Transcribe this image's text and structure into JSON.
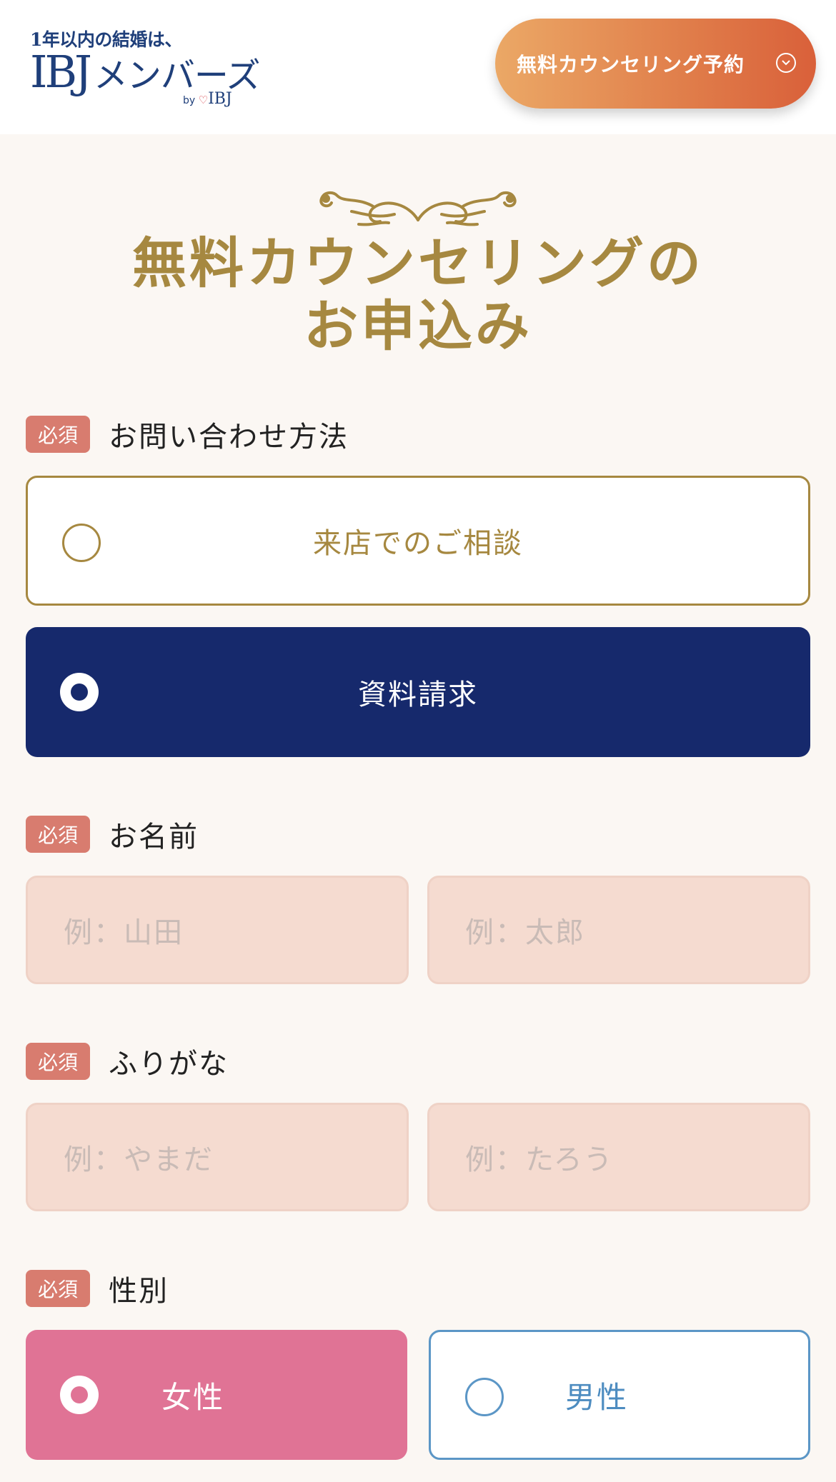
{
  "header": {
    "logo_tagline": "1年以内の結婚は、",
    "logo_brand": "IBJ",
    "logo_members": "メンバーズ",
    "logo_by": "by",
    "logo_by_brand": "IBJ",
    "cta_label": "無料カウンセリング予約",
    "cta_icon": "chevron-down-circle-icon",
    "colors": {
      "cta_start": "#eba866",
      "cta_end": "#d9603a",
      "brand_navy": "#1f3f7a"
    }
  },
  "page": {
    "title_line1": "無料カウンセリングの",
    "title_line2": "お申込み",
    "accent_gold": "#a68840"
  },
  "form": {
    "required_label": "必須",
    "contact_method": {
      "label": "お問い合わせ方法",
      "options": [
        {
          "label": "来店でのご相談",
          "selected": false
        },
        {
          "label": "資料請求",
          "selected": true
        }
      ]
    },
    "name": {
      "label": "お名前",
      "last_placeholder": "例：山田",
      "first_placeholder": "例：太郎"
    },
    "furigana": {
      "label": "ふりがな",
      "last_placeholder": "例：やまだ",
      "first_placeholder": "例：たろう"
    },
    "gender": {
      "label": "性別",
      "options": [
        {
          "label": "女性",
          "selected": true,
          "color": "#e07395"
        },
        {
          "label": "男性",
          "selected": false,
          "color": "#5b96c6"
        }
      ]
    }
  }
}
